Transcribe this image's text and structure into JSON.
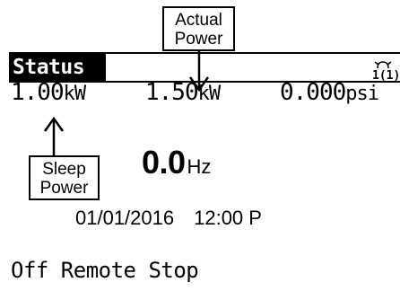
{
  "callouts": {
    "actual_power": [
      "Actual",
      "Power"
    ],
    "sleep_power": [
      "Sleep",
      "Power"
    ]
  },
  "status_bar": {
    "tab_label": "Status",
    "icon": "hand-1-icon",
    "icon_label": "1(1)"
  },
  "readings": {
    "sleep_power": {
      "value": "1.00",
      "unit": "kW"
    },
    "actual_power": {
      "value": "1.50",
      "unit": "kW"
    },
    "pressure": {
      "value": "0.000",
      "unit": "psi"
    }
  },
  "frequency": {
    "value": "0.0",
    "unit": "Hz"
  },
  "datetime": {
    "date": "01/01/2016",
    "time": "12:00 P"
  },
  "status_line": "Off Remote Stop"
}
